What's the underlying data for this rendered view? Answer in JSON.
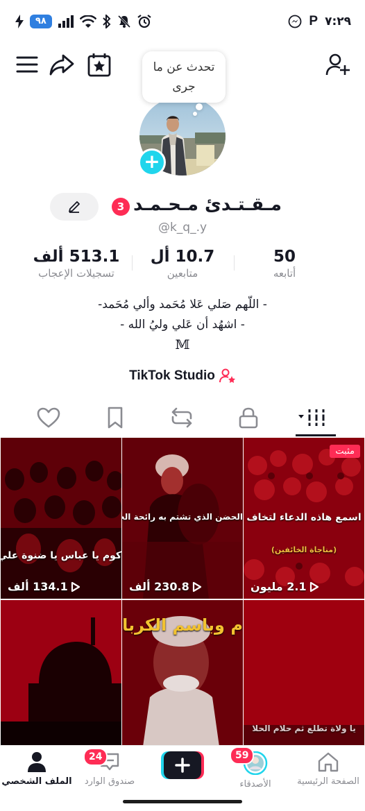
{
  "status_bar": {
    "battery": "٩٨",
    "time": "٧:٢٩",
    "p_letter": "P",
    "icons": [
      "charging-bolt-icon",
      "battery-icon",
      "signal-icon",
      "wifi-icon",
      "bluetooth-icon",
      "mute-icon",
      "alarm-icon",
      "messenger-icon"
    ]
  },
  "top_bar": {
    "icons": [
      "menu-icon",
      "share-icon",
      "calendar-star-icon",
      "add-friend-icon"
    ]
  },
  "bubble": {
    "text_line1": "تحدث عن ما",
    "text_line2": "جرى"
  },
  "profile": {
    "display_name": "مـقـتـدئ مـحـمـد",
    "notification_count": "3",
    "username": "@k_q_.y"
  },
  "stats": [
    {
      "value": "513.1 ألف",
      "label": "تسجيلات الإعجاب"
    },
    {
      "value": "10.7 أل",
      "label": "متابعين"
    },
    {
      "value": "50",
      "label": "أتابعه"
    }
  ],
  "bio": {
    "line1": "- اللّهم صَلي عَلا مُحَمد وألي مُحَمد-",
    "line2": "- اشهُد أن عَلي وليُ الله -",
    "line3": "𝕄"
  },
  "studio": {
    "label": "TikTok Studio"
  },
  "tabs": [
    "videos-tab",
    "private-tab",
    "reposts-tab",
    "favorites-tab",
    "liked-tab"
  ],
  "videos": [
    {
      "overlay": "كوم يا عباس يا ضنوة علي.",
      "views": "134.1 ألف"
    },
    {
      "overlay": "الحضن الذي تشتم به رائحة الحسين",
      "views": "230.8 ألف"
    },
    {
      "overlay": "اسمع هاذه الدعاء لتخاف",
      "sub": "(مناجاة الخائفين)",
      "views": "2.1 مليون",
      "pinned": "مثبت"
    },
    {
      "overlay": "",
      "views": ""
    },
    {
      "overlay": "م وباسم الكربا",
      "views": ""
    },
    {
      "overlay": "يا ولاة تطلع ثم حلام الحلا",
      "views": ""
    }
  ],
  "bottom_nav": {
    "profile": "الملف الشخصي",
    "inbox": "صندوق الوارد",
    "inbox_badge": "24",
    "friends": "الأصدقاء",
    "friends_badge": "59",
    "home": "الصفحة الرئيسية"
  },
  "colors": {
    "accent": "#fe2c55",
    "cyan": "#20d5ec",
    "text": "#161823",
    "muted": "#8a8b91"
  }
}
